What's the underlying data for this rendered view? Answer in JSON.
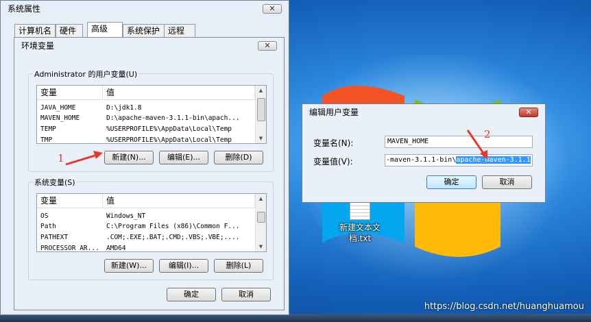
{
  "desktop": {
    "file_icon_label": "新建文本文\n档.txt",
    "watermark": "https://blog.csdn.net/huanghuamou"
  },
  "system_properties": {
    "title": "系统属性",
    "close_label": "✕",
    "tabs": [
      {
        "label": "计算机名",
        "active": false
      },
      {
        "label": "硬件",
        "active": false
      },
      {
        "label": "高级",
        "active": true
      },
      {
        "label": "系统保护",
        "active": false
      },
      {
        "label": "远程",
        "active": false
      }
    ]
  },
  "environment_variables": {
    "title": "环境变量",
    "close_label": "✕",
    "user_group_label": "Administrator 的用户变量(U)",
    "system_group_label": "系统变量(S)",
    "columns": {
      "name": "变量",
      "value": "值"
    },
    "user_vars": [
      {
        "name": "JAVA_HOME",
        "value": "D:\\jdk1.8"
      },
      {
        "name": "MAVEN_HOME",
        "value": "D:\\apache-maven-3.1.1-bin\\apach..."
      },
      {
        "name": "TEMP",
        "value": "%USERPROFILE%\\AppData\\Local\\Temp"
      },
      {
        "name": "TMP",
        "value": "%USERPROFILE%\\AppData\\Local\\Temp"
      }
    ],
    "system_vars": [
      {
        "name": "OS",
        "value": "Windows_NT"
      },
      {
        "name": "Path",
        "value": "C:\\Program Files (x86)\\Common F..."
      },
      {
        "name": "PATHEXT",
        "value": ".COM;.EXE;.BAT;.CMD;.VBS;.VBE;...."
      },
      {
        "name": "PROCESSOR_AR...",
        "value": "AMD64"
      }
    ],
    "user_buttons": {
      "new": "新建(N)...",
      "edit": "编辑(E)...",
      "delete": "删除(D)"
    },
    "system_buttons": {
      "new": "新建(W)...",
      "edit": "编辑(I)...",
      "delete": "删除(L)"
    },
    "ok": "确定",
    "cancel": "取消"
  },
  "edit_user_variable": {
    "title": "编辑用户变量",
    "close_label": "✕",
    "name_label": "变量名(N):",
    "name_value": "MAVEN_HOME",
    "value_label": "变量值(V):",
    "value_prefix": "-maven-3.1.1-bin\\",
    "value_selected": "apache-maven-3.1.1",
    "ok": "确定",
    "cancel": "取消"
  },
  "annotations": {
    "one": "1",
    "two": "2"
  },
  "colors": {
    "annotation": "#e53a2b",
    "selection": "#3399ff",
    "close_red": "#c2352a"
  }
}
